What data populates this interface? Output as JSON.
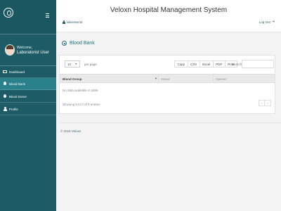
{
  "app": {
    "title": "Veloxn Hospital Management System"
  },
  "header": {
    "role_link": "laboratorist",
    "logout_label": "Log Out",
    "logout_icon": "sign-out-icon"
  },
  "sidebar": {
    "logo_icon": "hospital-logo-icon",
    "menu_icon": "hamburger-menu-icon",
    "welcome": "Welcome,",
    "user_name": "Laboratorist User",
    "items": [
      {
        "label": "Dashboard",
        "icon": "monitor-icon",
        "active": false
      },
      {
        "label": "Blood Bank",
        "icon": "blood-drop-icon",
        "active": true
      },
      {
        "label": "Blood Donor",
        "icon": "blood-drop-icon",
        "active": false
      },
      {
        "label": "Profile",
        "icon": "user-icon",
        "active": false
      }
    ]
  },
  "page": {
    "title": "Blood Bank",
    "title_icon": "circle-dot-icon"
  },
  "table_controls": {
    "page_length": "10",
    "per_page_label": "per page",
    "export_buttons": [
      "Copy",
      "CSV",
      "Excel",
      "PDF",
      "Print"
    ],
    "search_label": "Search:",
    "search_value": ""
  },
  "table": {
    "columns": [
      "Blood Group",
      "Status",
      "Options"
    ],
    "rows": [],
    "empty_message": "No data available in table",
    "info": "Showing 0 to 0 of 0 entries",
    "pager": {
      "prev": "‹",
      "next": "›"
    }
  },
  "footer": {
    "copyright": "© 2018 ",
    "brand": "Veloxn"
  },
  "colors": {
    "sidebar": "#1d5c66",
    "sidebar_active": "#2a818c",
    "accent": "#2c6f7a"
  }
}
